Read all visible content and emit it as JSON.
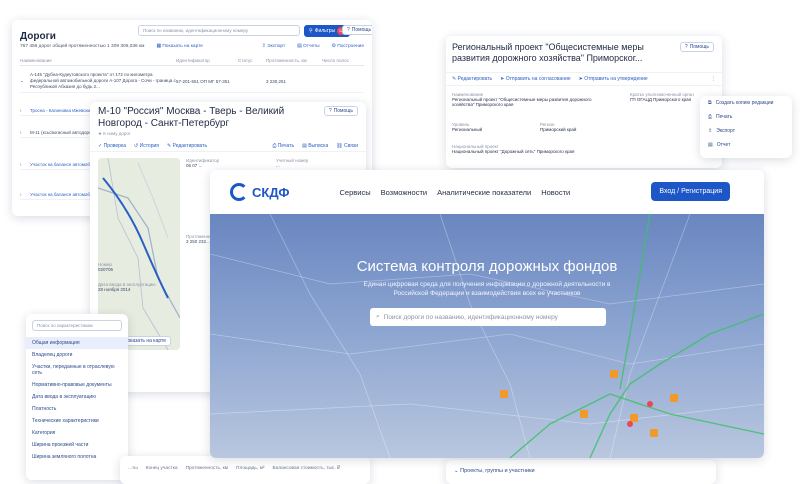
{
  "roads": {
    "title": "Дороги",
    "search_placeholder": "Поиск по названию, идентификационному номеру",
    "filter_label": "Фильтры",
    "filter_count": "12",
    "help_label": "Помощь",
    "meta": {
      "count": "767 456 дорог общей протяженностью 1 309 306,036 км",
      "show_map": "Показать на карте",
      "export": "Экспорт",
      "reports": "Отчеты",
      "construct": "Построение"
    },
    "columns": [
      "Наименование",
      "Идентификатор",
      "Статус",
      "Протяженность, км",
      "Число полос"
    ],
    "rows": [
      {
        "name": "А-145 \"Дубна-Кудеутовского проекта\" от 172 по километра федеральной автомобильной дороги А-107 Дорога - Сочи - граница с Республикой Абхазия до будь 2...",
        "id": "57-201-551 ОП МГ 57-351",
        "length": "3 230,251"
      },
      {
        "name": "Тросна - Калиновка Ижевским участок",
        "id": "",
        "length": ""
      },
      {
        "name": "М-11 (ксьсвогасный автодороги) - Петербург",
        "id": "",
        "length": ""
      },
      {
        "name": "Участок на балансе автомобильные дороги",
        "id": "",
        "length": ""
      },
      {
        "name": "Участок на балансе автомобильной дороги",
        "id": "",
        "length": ""
      }
    ]
  },
  "project": {
    "title": "Региональный проект \"Общесистемные меры развития дорожного хозяйства\" Приморског...",
    "help": "Помощь",
    "tools": [
      "Редактировать",
      "Отправить на согласование",
      "Отправить на утверждение"
    ],
    "fields": [
      {
        "label": "Наименование",
        "value": "Региональный проект \"Общесистемные меры развития дорожного хозяйства\" Приморского края"
      },
      {
        "label": "Кратко уполномоченный орган",
        "value": "ГП ОГАЦД Приморского края"
      },
      {
        "label": "Уровень",
        "value": "Региональный"
      },
      {
        "label": "Регион",
        "value": "Приморский край"
      },
      {
        "label": "Национальный проект",
        "value": "Национальный проект \"Дорожный сеть\" Приморского края"
      }
    ],
    "footer": "Проекты, группы и участники"
  },
  "project_menu": {
    "items": [
      "Создать копию редакции",
      "Печать",
      "Экспорт",
      "Отчет"
    ]
  },
  "m10": {
    "title": "М-10 \"Россия\" Москва - Тверь - Великий Новгород - Санкт-Петербург",
    "help": "Помощь",
    "category": "К ному дорог",
    "tools": [
      "Проверка",
      "История",
      "Редактировать",
      "Печать",
      "Выписка",
      "Связи"
    ],
    "map_button": "Показать на карте",
    "fields": [
      {
        "label": "Идентификатор",
        "value": "06 07 ..."
      },
      {
        "label": "Учетный номер",
        "value": "..."
      },
      {
        "label": "Номер",
        "value": "020705"
      },
      {
        "label": "Дата ввода в эксплуатацию",
        "value": "28 ноября 2014"
      },
      {
        "label": "Протяженность",
        "value": "3 250 232..."
      }
    ]
  },
  "filters": {
    "search_placeholder": "Поиск по характеристикам",
    "items": [
      {
        "label": "Общая информация",
        "active": true
      },
      {
        "label": "Владелец дороги",
        "active": false
      },
      {
        "label": "Участки, переданные в отраслевую сеть",
        "active": false
      },
      {
        "label": "Нормативно-правовые документы",
        "active": false
      },
      {
        "label": "Дата ввода в эксплуатацию",
        "active": false
      },
      {
        "label": "Платность",
        "active": false
      },
      {
        "label": "Технические характеристики",
        "active": false
      },
      {
        "label": "Категория",
        "active": false
      },
      {
        "label": "Ширина проезжей части",
        "active": false
      },
      {
        "label": "Ширина земляного полотна",
        "active": false
      }
    ]
  },
  "btable": {
    "columns": [
      "...ты",
      "Конец участка",
      "Протяженность, км",
      "Площадь, м²",
      "Балансовая стоимость, тыс. ₽"
    ]
  },
  "hero": {
    "brand": "СКДФ",
    "menu": [
      "Сервисы",
      "Возможности",
      "Аналитические показатели",
      "Новости"
    ],
    "login": "Вход / Регистрация",
    "heading": "Система контроля дорожных фондов",
    "subheading": "Единая цифровая среда для получения информации о дорожной деятельности в Российской Федерации и взаимодействия всех ее участников",
    "search_placeholder": "Поиск дороги по названию, идентификационному номеру"
  },
  "colors": {
    "accent": "#1d56c6",
    "text": "#1f2a44",
    "muted": "#8a93a6"
  }
}
